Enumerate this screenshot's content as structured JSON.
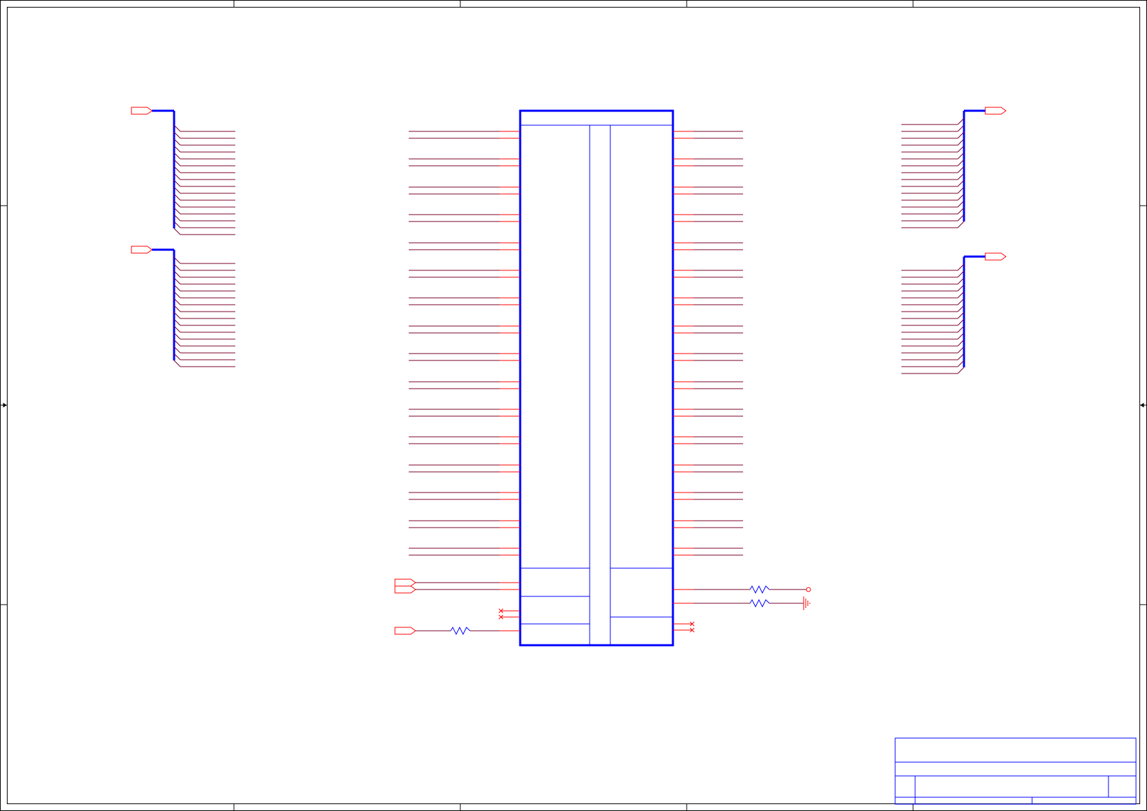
{
  "sheet": {
    "title": "",
    "colors": {
      "frame": "#000000",
      "bus": "#0000ff",
      "wire": "#7a0026",
      "pin": "#ff0000",
      "port": "#ff0000",
      "component": "#0000ff",
      "resistor": "#0000ff",
      "noconnect": "#ff0000",
      "ground": "#ff0000",
      "title_block": "#0000ff"
    }
  },
  "icons": {
    "offpage": "offpage-connector-icon",
    "resistor": "resistor-icon",
    "ground": "ground-icon",
    "no_connect": "no-connect-icon",
    "test_point": "test-point-icon"
  }
}
